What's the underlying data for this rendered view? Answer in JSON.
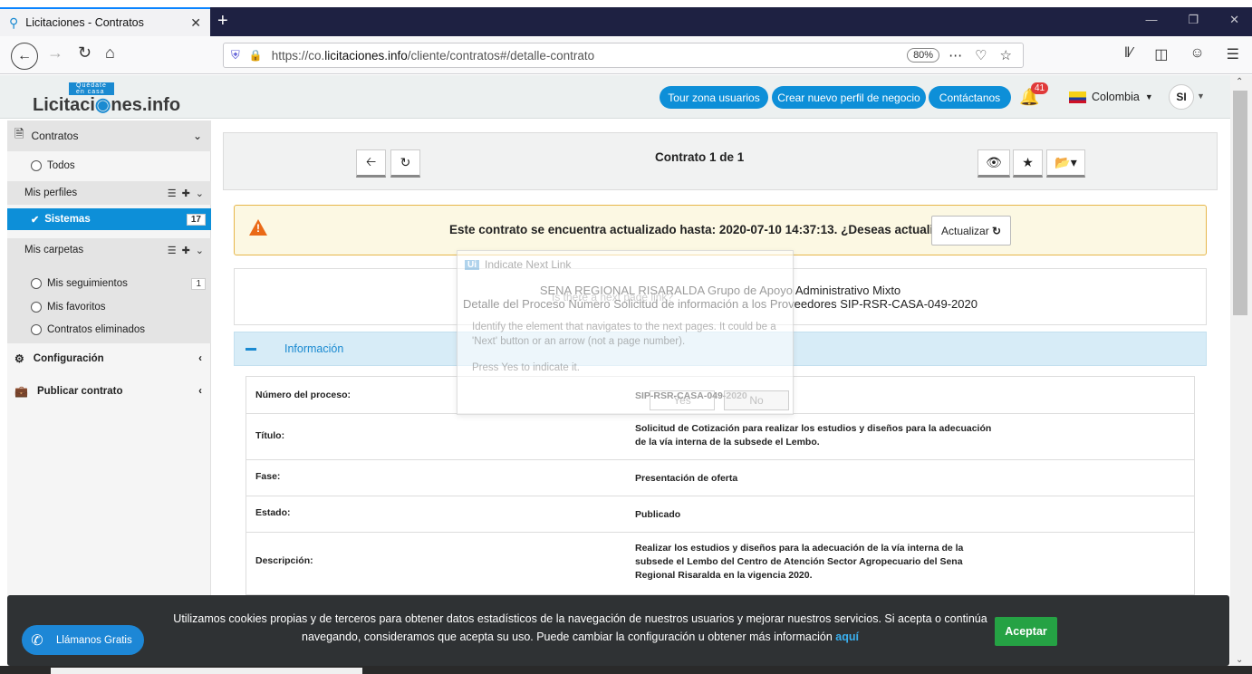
{
  "browser": {
    "tab_title": "Licitaciones - Contratos",
    "tab_close": "✕",
    "new_tab": "+",
    "url_prefix": "https://co.",
    "url_domain": "licitaciones.info",
    "url_path": "/cliente/contratos#/detalle-contrato",
    "zoom": "80%"
  },
  "header": {
    "logo_tagline": "Quédate en casa",
    "logo_text_a": "Licitaci",
    "logo_text_b": "nes.info",
    "tour_btn": "Tour zona usuarios",
    "create_btn": "Crear nuevo perfil de negocio",
    "contact_btn": "Contáctanos",
    "notif_count": "41",
    "country": "Colombia",
    "user_initials": "SI"
  },
  "sidebar": {
    "contracts_label": "Contratos",
    "all_label": "Todos",
    "my_profiles_label": "Mis perfiles",
    "profile_item": "Sistemas",
    "profile_count": "17",
    "my_folders_label": "Mis carpetas",
    "folders": [
      {
        "label": "Mis seguimientos",
        "count": "1"
      },
      {
        "label": "Mis favoritos",
        "count": ""
      },
      {
        "label": "Contratos eliminados",
        "count": ""
      }
    ],
    "config_label": "Configuración",
    "publish_label": "Publicar contrato"
  },
  "toolbar": {
    "title": "Contrato 1 de 1"
  },
  "alert": {
    "message": "Este contrato se encuentra actualizado hasta: 2020-07-10 14:37:13.  ¿Deseas actualizarlo?",
    "button": "Actualizar"
  },
  "entity": {
    "line1": "SENA REGIONAL RISARALDA Grupo de Apoyo Administrativo Mixto",
    "line2": "Detalle del Proceso Número Solicitud de información a los Proveedores SIP-RSR-CASA-049-2020"
  },
  "info": {
    "section_label": "Información",
    "rows": [
      {
        "key": "Número del proceso:",
        "value": "SIP-RSR-CASA-049-2020"
      },
      {
        "key": "Título:",
        "value": "Solicitud de Cotización para realizar los estudios y diseños para la adecuación de la vía interna de la subsede el Lembo."
      },
      {
        "key": "Fase:",
        "value": "Presentación de oferta"
      },
      {
        "key": "Estado:",
        "value": "Publicado"
      },
      {
        "key": "Descripción:",
        "value": "Realizar los estudios y diseños para la adecuación de la vía interna de la subsede el Lembo del Centro de Atención Sector Agropecuario del Sena Regional Risaralda en la vigencia 2020."
      }
    ]
  },
  "overlay": {
    "badge": "Ui",
    "title": "Indicate Next Link",
    "subtitle": "Is there a next page link?",
    "body": "Identify the element that navigates to the next pages. It could be a 'Next' button or an arrow (not a page number).",
    "press": "Press Yes to indicate it.",
    "yes": "Yes",
    "no": "No"
  },
  "cookie": {
    "text": "Utilizamos cookies propias y de terceros para obtener datos estadísticos de la navegación de nuestros usuarios y mejorar nuestros servicios. Si acepta o continúa navegando, consideramos que acepta su uso. Puede cambiar la configuración u obtener más información ",
    "link": "aquí",
    "accept": "Aceptar"
  },
  "call": {
    "label": "Llámanos Gratis"
  }
}
